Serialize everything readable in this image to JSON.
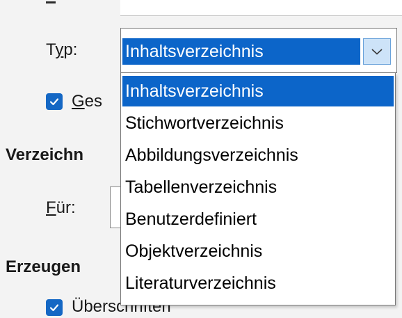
{
  "typ": {
    "label": "Typ:",
    "value": "Inhaltsverzeichnis"
  },
  "dropdown": {
    "options": [
      "Inhaltsverzeichnis",
      "Stichwortverzeichnis",
      "Abbildungsverzeichnis",
      "Tabellenverzeichnis",
      "Benutzerdefiniert",
      "Objektverzeichnis",
      "Literaturverzeichnis"
    ],
    "selected_index": 0
  },
  "checkbox_ges": {
    "label": "Ges",
    "checked": true
  },
  "section_verzeichnis": {
    "title": "Verzeichn"
  },
  "fuer": {
    "label": "Für:"
  },
  "section_erzeugen": {
    "title": "Erzeugen"
  },
  "checkbox_ueberschriften": {
    "label": "Überschriften",
    "checked": true
  },
  "colors": {
    "accent": "#0c65c9",
    "checkbox": "#1467c4"
  }
}
